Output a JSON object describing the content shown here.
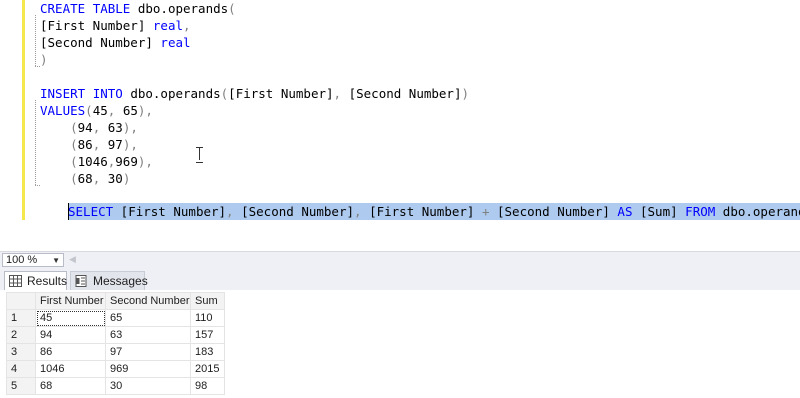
{
  "editor": {
    "lines": [
      {
        "segments": [
          {
            "t": "CREATE",
            "c": "kw"
          },
          {
            "t": " ",
            "c": "tx"
          },
          {
            "t": "TABLE",
            "c": "kw"
          },
          {
            "t": " dbo.operands",
            "c": "tx"
          },
          {
            "t": "(",
            "c": "op"
          }
        ]
      },
      {
        "segments": [
          {
            "t": "[First Number] ",
            "c": "tx"
          },
          {
            "t": "real",
            "c": "kw"
          },
          {
            "t": ",",
            "c": "op"
          }
        ]
      },
      {
        "segments": [
          {
            "t": "[Second Number] ",
            "c": "tx"
          },
          {
            "t": "real",
            "c": "kw"
          }
        ]
      },
      {
        "segments": [
          {
            "t": ")",
            "c": "op"
          }
        ]
      },
      {
        "segments": []
      },
      {
        "segments": [
          {
            "t": "INSERT",
            "c": "kw"
          },
          {
            "t": " ",
            "c": "tx"
          },
          {
            "t": "INTO",
            "c": "kw"
          },
          {
            "t": " dbo.operands",
            "c": "tx"
          },
          {
            "t": "(",
            "c": "op"
          },
          {
            "t": "[First Number]",
            "c": "tx"
          },
          {
            "t": ", ",
            "c": "op"
          },
          {
            "t": "[Second Number]",
            "c": "tx"
          },
          {
            "t": ")",
            "c": "op"
          }
        ]
      },
      {
        "segments": [
          {
            "t": "VALUES",
            "c": "kw"
          },
          {
            "t": "(",
            "c": "op"
          },
          {
            "t": "45",
            "c": "tx"
          },
          {
            "t": ", ",
            "c": "op"
          },
          {
            "t": "65",
            "c": "tx"
          },
          {
            "t": "),",
            "c": "op"
          }
        ]
      },
      {
        "segments": [
          {
            "t": "    ",
            "c": "tx"
          },
          {
            "t": "(",
            "c": "op"
          },
          {
            "t": "94",
            "c": "tx"
          },
          {
            "t": ", ",
            "c": "op"
          },
          {
            "t": "63",
            "c": "tx"
          },
          {
            "t": "),",
            "c": "op"
          }
        ]
      },
      {
        "segments": [
          {
            "t": "    ",
            "c": "tx"
          },
          {
            "t": "(",
            "c": "op"
          },
          {
            "t": "86",
            "c": "tx"
          },
          {
            "t": ", ",
            "c": "op"
          },
          {
            "t": "97",
            "c": "tx"
          },
          {
            "t": "),",
            "c": "op"
          }
        ]
      },
      {
        "segments": [
          {
            "t": "    ",
            "c": "tx"
          },
          {
            "t": "(",
            "c": "op"
          },
          {
            "t": "1046",
            "c": "tx"
          },
          {
            "t": ",",
            "c": "op"
          },
          {
            "t": "969",
            "c": "tx"
          },
          {
            "t": "),",
            "c": "op"
          }
        ]
      },
      {
        "segments": [
          {
            "t": "    ",
            "c": "tx"
          },
          {
            "t": "(",
            "c": "op"
          },
          {
            "t": "68",
            "c": "tx"
          },
          {
            "t": ", ",
            "c": "op"
          },
          {
            "t": "30",
            "c": "tx"
          },
          {
            "t": ")",
            "c": "op"
          }
        ]
      },
      {
        "segments": []
      },
      {
        "selected": true,
        "segments": [
          {
            "t": "    ",
            "c": "tx"
          },
          {
            "t": "SELECT",
            "c": "kw"
          },
          {
            "t": " [First Number]",
            "c": "tx"
          },
          {
            "t": ", ",
            "c": "op"
          },
          {
            "t": "[Second Number]",
            "c": "tx"
          },
          {
            "t": ", ",
            "c": "op"
          },
          {
            "t": "[First Number]",
            "c": "tx"
          },
          {
            "t": " + ",
            "c": "op"
          },
          {
            "t": "[Second Number]",
            "c": "tx"
          },
          {
            "t": " ",
            "c": "tx"
          },
          {
            "t": "AS",
            "c": "kw"
          },
          {
            "t": " [Sum] ",
            "c": "tx"
          },
          {
            "t": "FROM",
            "c": "kw"
          },
          {
            "t": " dbo.operands",
            "c": "tx"
          }
        ]
      }
    ]
  },
  "zoom": {
    "value": "100 %",
    "dropdown_icon": "chevron-down-icon"
  },
  "results": {
    "tabs": [
      {
        "label": "Results",
        "icon": "grid-icon",
        "active": true
      },
      {
        "label": "Messages",
        "icon": "messages-icon",
        "active": false
      }
    ],
    "columns": [
      "First Number",
      "Second Number",
      "Sum"
    ],
    "rows": [
      {
        "num": "1",
        "cells": [
          "45",
          "65",
          "110"
        ]
      },
      {
        "num": "2",
        "cells": [
          "94",
          "63",
          "157"
        ]
      },
      {
        "num": "3",
        "cells": [
          "86",
          "97",
          "183"
        ]
      },
      {
        "num": "4",
        "cells": [
          "1046",
          "969",
          "2015"
        ]
      },
      {
        "num": "5",
        "cells": [
          "68",
          "30",
          "98"
        ]
      }
    ]
  }
}
